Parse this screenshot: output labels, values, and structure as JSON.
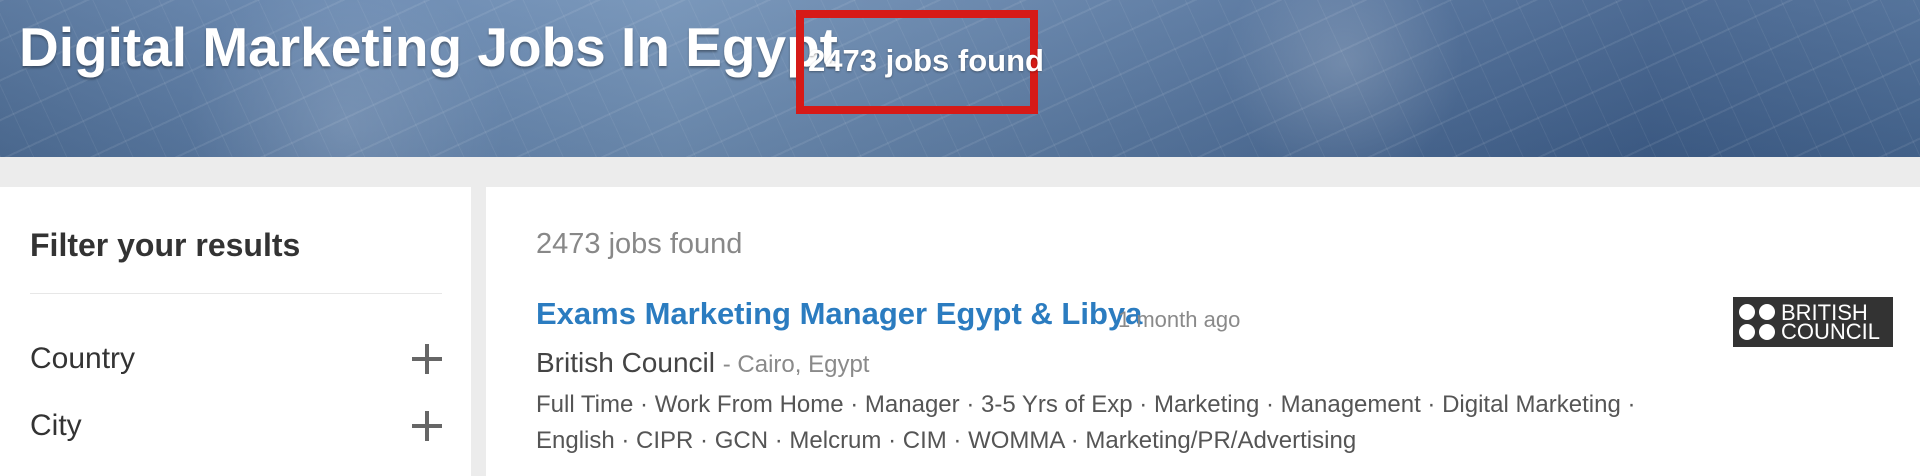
{
  "header": {
    "title": "Digital Marketing Jobs In Egypt",
    "count_text": "2473 jobs found"
  },
  "sidebar": {
    "title": "Filter your results",
    "filters": [
      {
        "label": "Country",
        "icon": "plus"
      },
      {
        "label": "City",
        "icon": "plus"
      }
    ]
  },
  "results": {
    "count_text": "2473 jobs found",
    "jobs": [
      {
        "title": "Exams Marketing Manager Egypt & Libya",
        "posted": "1 month ago",
        "company": "British Council",
        "location": "- Cairo, Egypt",
        "tags": [
          "Full Time",
          "Work From Home",
          "Manager",
          "3-5 Yrs of Exp",
          "Marketing",
          "Management",
          "Digital Marketing",
          "English",
          "CIPR",
          "GCN",
          "Melcrum",
          "CIM",
          "WOMMA",
          "Marketing/PR/Advertising"
        ],
        "logo": {
          "line1": "BRITISH",
          "line2": "COUNCIL"
        }
      }
    ]
  },
  "colors": {
    "accent_link": "#2b7cc0",
    "highlight_box": "#d61a17"
  }
}
